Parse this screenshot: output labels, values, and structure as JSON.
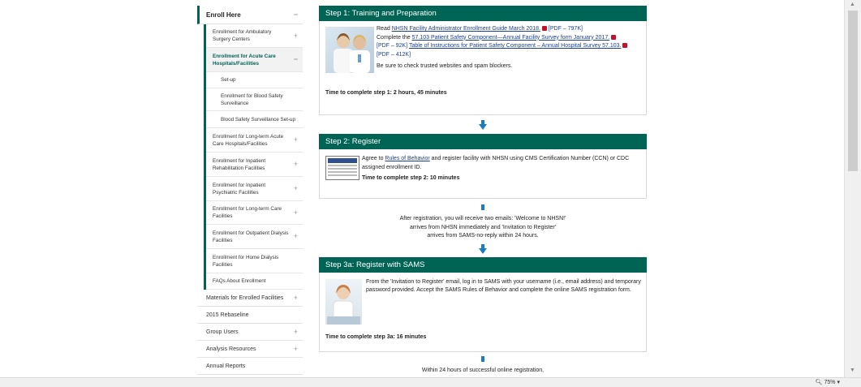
{
  "sidebar": {
    "enroll_here": "Enroll Here",
    "enroll_symbol": "−",
    "items": [
      {
        "label": "Enrollment for Ambulatory Surgery Centers",
        "symbol": "+"
      },
      {
        "label": "Enrollment for Acute Care Hospitals/Facilities",
        "symbol": "−"
      },
      {
        "label": "Enrollment for Long-term Acute Care Hospitals/Facilities",
        "symbol": "+"
      },
      {
        "label": "Enrollment for Inpatient Rehabilitation Facilities",
        "symbol": "+"
      },
      {
        "label": "Enrollment for Inpatient Psychiatric Facilities",
        "symbol": "+"
      },
      {
        "label": "Enrollment for Long-term Care Facilities",
        "symbol": "+"
      },
      {
        "label": "Enrollment for Outpatient Dialysis Facilities",
        "symbol": "+"
      },
      {
        "label": "Enrollment for Home Dialysis Facilities",
        "symbol": ""
      },
      {
        "label": "FAQs About Enrollment",
        "symbol": ""
      }
    ],
    "subitems": [
      "Set-up",
      "Enrollment for Blood Safety Surveillance",
      "Blood Safety Surveillance Set-up"
    ],
    "top_items": [
      {
        "label": "Materials for Enrolled Facilities",
        "symbol": "+"
      },
      {
        "label": "2015 Rebaseline",
        "symbol": ""
      },
      {
        "label": "Group Users",
        "symbol": "+"
      },
      {
        "label": "Analysis Resources",
        "symbol": "+"
      },
      {
        "label": "Annual Reports",
        "symbol": ""
      }
    ]
  },
  "step1": {
    "title": "Step 1: Training and Preparation",
    "read": "Read",
    "link1": "NHSN Facility Administrator Enrollment Guide March 2018.",
    "pdf1": "[PDF – 797K]",
    "complete_the": "Complete the",
    "link2": "57.103 Patient Safety Component—Annual Facility Survey form January 2017.",
    "pdf2": "[PDF – 92K]",
    "link3": "Table of Instructions for Patient Safety Component – Annual Hospital Survey 57.103.",
    "pdf3": "[PDF – 412K]",
    "note": "Be sure to check trusted websites and spam blockers.",
    "time": "Time to complete step 1: 2 hours, 45 minutes"
  },
  "step2": {
    "title": "Step 2: Register",
    "agree_to": "Agree to",
    "rules_link": "Rules of Behavior",
    "rest": "and register facility with NHSN using CMS Certification Number (CCN) or CDC assigned enrollment ID.",
    "time": "Time to complete step 2: 10 minutes"
  },
  "after_registration": {
    "line1": "After registration, you will receive two emails: 'Welcome to NHSN!'",
    "line2": "arrives from NHSN immediately and 'Invitation to Register'",
    "line3": "arrives from SAMS-no-reply within 24 hours."
  },
  "step3a": {
    "title": "Step 3a: Register with SAMS",
    "body": "From the 'Invitation to Register' email, log in to SAMS with your username (i.e., email address) and temporary password provided. Accept the SAMS Rules of Behavior and complete the online SAMS registration form.",
    "time": "Time to complete step 3a: 16 minutes"
  },
  "bottom_text": "Within 24 hours of successful online registration,",
  "status": {
    "zoom": "75%"
  },
  "colors": {
    "accent": "#006455",
    "arrow": "#1a7dc2",
    "link": "#1a3f8f",
    "pdf": "#c8102e"
  }
}
